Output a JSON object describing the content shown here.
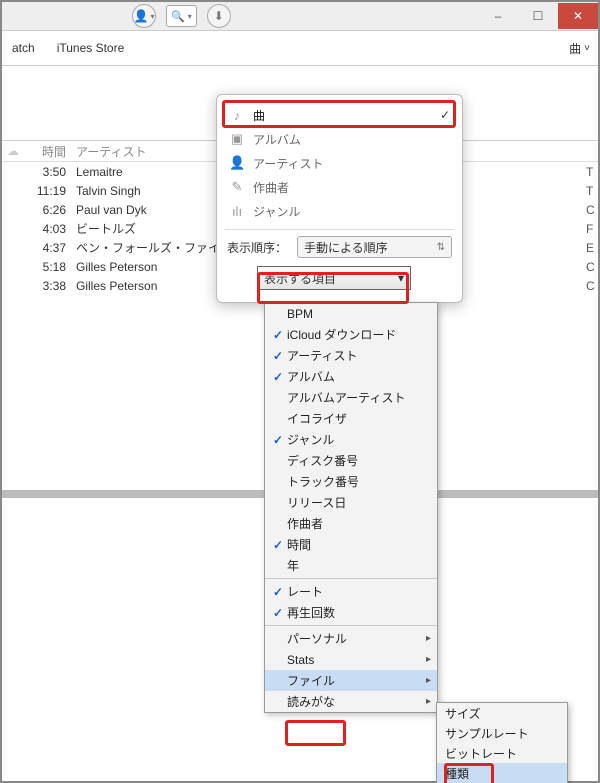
{
  "titlebar": {
    "minimize": "–",
    "maximize": "☐",
    "close": "✕"
  },
  "toolbar": {
    "tab_match": "atch",
    "tab_store": "iTunes Store",
    "view_label": "曲",
    "view_caret": "˅"
  },
  "table": {
    "header_time": "時間",
    "header_artist": "アーティスト",
    "rows": [
      {
        "time": "3:50",
        "artist": "Lemaitre",
        "extra": "T"
      },
      {
        "time": "11:19",
        "artist": "Talvin Singh",
        "extra": "T"
      },
      {
        "time": "6:26",
        "artist": "Paul van Dyk",
        "extra": "C"
      },
      {
        "time": "4:03",
        "artist": "ビートルズ",
        "extra": "F"
      },
      {
        "time": "4:37",
        "artist": "ベン・フォールズ・ファイブ",
        "extra": "E"
      },
      {
        "time": "5:18",
        "artist": "Gilles Peterson",
        "extra": "C"
      },
      {
        "time": "3:38",
        "artist": "Gilles Peterson",
        "extra": "C"
      }
    ]
  },
  "popup": {
    "categories": [
      {
        "icon": "♪",
        "label": "曲",
        "selected": true
      },
      {
        "icon": "▣",
        "label": "アルバム",
        "selected": false
      },
      {
        "icon": "👤",
        "label": "アーティスト",
        "selected": false
      },
      {
        "icon": "✎",
        "label": "作曲者",
        "selected": false
      },
      {
        "icon": "ılı",
        "label": "ジャンル",
        "selected": false
      }
    ],
    "order_label": "表示順序：",
    "order_value": "手動による順序",
    "columns_btn": "表示する項目",
    "columns_caret": "▾"
  },
  "col_menu": {
    "groups": [
      [
        {
          "label": "BPM",
          "checked": false
        },
        {
          "label": "iCloud ダウンロード",
          "checked": true
        },
        {
          "label": "アーティスト",
          "checked": true
        },
        {
          "label": "アルバム",
          "checked": true
        },
        {
          "label": "アルバムアーティスト",
          "checked": false
        },
        {
          "label": "イコライザ",
          "checked": false
        },
        {
          "label": "ジャンル",
          "checked": true
        },
        {
          "label": "ディスク番号",
          "checked": false
        },
        {
          "label": "トラック番号",
          "checked": false
        },
        {
          "label": "リリース日",
          "checked": false
        },
        {
          "label": "作曲者",
          "checked": false
        },
        {
          "label": "時間",
          "checked": true
        },
        {
          "label": "年",
          "checked": false
        }
      ],
      [
        {
          "label": "レート",
          "checked": true
        },
        {
          "label": "再生回数",
          "checked": true
        }
      ],
      [
        {
          "label": "パーソナル",
          "submenu": true
        },
        {
          "label": "Stats",
          "submenu": true
        },
        {
          "label": "ファイル",
          "submenu": true,
          "highlighted": true
        },
        {
          "label": "読みがな",
          "submenu": true
        }
      ]
    ]
  },
  "sub_menu": {
    "items": [
      {
        "label": "サイズ"
      },
      {
        "label": "サンプルレート"
      },
      {
        "label": "ビットレート"
      },
      {
        "label": "種類",
        "highlighted": true
      }
    ]
  },
  "icons": {
    "cloud": "☁",
    "user": "👤",
    "download": "⬇",
    "magnifier": "🔍",
    "caret_down": "▾",
    "check": "✓",
    "updown": "⇅",
    "right": "▸"
  }
}
